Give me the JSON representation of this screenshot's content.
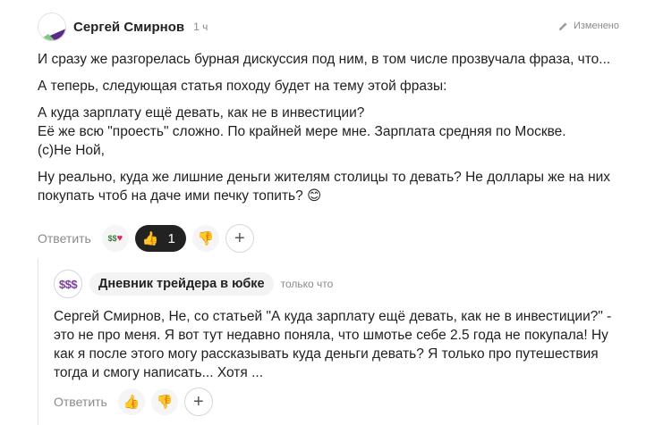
{
  "comment": {
    "author": "Сергей Смирнов",
    "time": "1 ч",
    "edited": "Изменено",
    "paragraphs": [
      "И сразу же разгорелась бурная дискуссия под ним, в том числе прозвучала фраза, что...",
      "А теперь, следующая статья походу будет на тему этой фразы:",
      "А куда зарплату ещё девать, как не в инвестиции?\nЕё же всю \"проесть\" сложно. По крайней мере мне. Зарплата средняя по Москве.\n(с)Не Ной,",
      "Ну реально, куда же лишние деньги жителям столицы то девать? Не доллары же на них покупать чтоб на даче ими печку топить? 😊"
    ],
    "reply_label": "Ответить",
    "like_count": "1",
    "icons": {
      "money_heart": "$$",
      "like": "👍",
      "dislike": "👎",
      "add": "+"
    }
  },
  "reply": {
    "avatar_text": "$$$",
    "author": "Дневник трейдера в юбке",
    "time": "только что",
    "text": "Сергей Смирнов, Не, со статьей \"А куда зарплату ещё девать, как не в инвестиции?\" - это не про меня. Я вот тут недавно поняла, что шмотье себе 2.5 года не покупала! Ну как я после этого могу рассказывать куда деньги девать? Я только про путешествия тогда и смогу написать... Хотя ...",
    "reply_label": "Ответить",
    "icons": {
      "like": "👍",
      "dislike": "👎",
      "add": "+"
    }
  },
  "colors": {
    "accent_purple": "#7b3fa0",
    "muted_text": "#8a8a8a",
    "active_reaction_bg": "#222222"
  }
}
